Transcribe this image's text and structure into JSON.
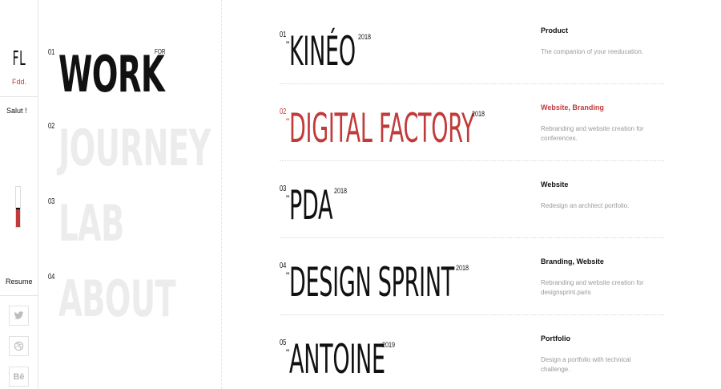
{
  "brand": {
    "logo": "FL",
    "subtitle": "Fdd."
  },
  "sidebar": {
    "greeting": "Salut !",
    "resume": "Resume",
    "progress": 0.45,
    "social": [
      {
        "name": "twitter-icon",
        "glyph": "🐦"
      },
      {
        "name": "dribbble-icon",
        "glyph": "◎"
      },
      {
        "name": "behance-icon",
        "glyph": "Bē"
      }
    ]
  },
  "nav": {
    "for_label": "FOR",
    "items": [
      {
        "num": "01",
        "label": "WORK",
        "active": true
      },
      {
        "num": "02",
        "label": "JOURNEY",
        "active": false
      },
      {
        "num": "03",
        "label": "LAB",
        "active": false
      },
      {
        "num": "04",
        "label": "ABOUT",
        "active": false
      }
    ]
  },
  "projects": [
    {
      "num": "01",
      "title": "KINÉO",
      "year": "2018",
      "category": "Product",
      "description": "The companion of your reeducation.",
      "highlight": false
    },
    {
      "num": "02",
      "title": "DIGITAL FACTORY",
      "year": "2018",
      "category": "Website, Branding",
      "description": "Rebranding and website creation for conferences.",
      "highlight": true
    },
    {
      "num": "03",
      "title": "PDA",
      "year": "2018",
      "category": "Website",
      "description": "Redesign an architect portfolio.",
      "highlight": false
    },
    {
      "num": "04",
      "title": "DESIGN SPRINT",
      "year": "2018",
      "category": "Branding, Website",
      "description": "Rebranding and website creation for designsprint.paris",
      "highlight": false
    },
    {
      "num": "05",
      "title": "ANTOINE",
      "year": "2019",
      "category": "Portfolio",
      "description": "Design a portfolio with technical challenge.",
      "highlight": false
    }
  ],
  "colors": {
    "accent": "#c23a3a",
    "inactive_nav": "#ececec",
    "text": "#111111",
    "muted": "#9a9a9a"
  }
}
